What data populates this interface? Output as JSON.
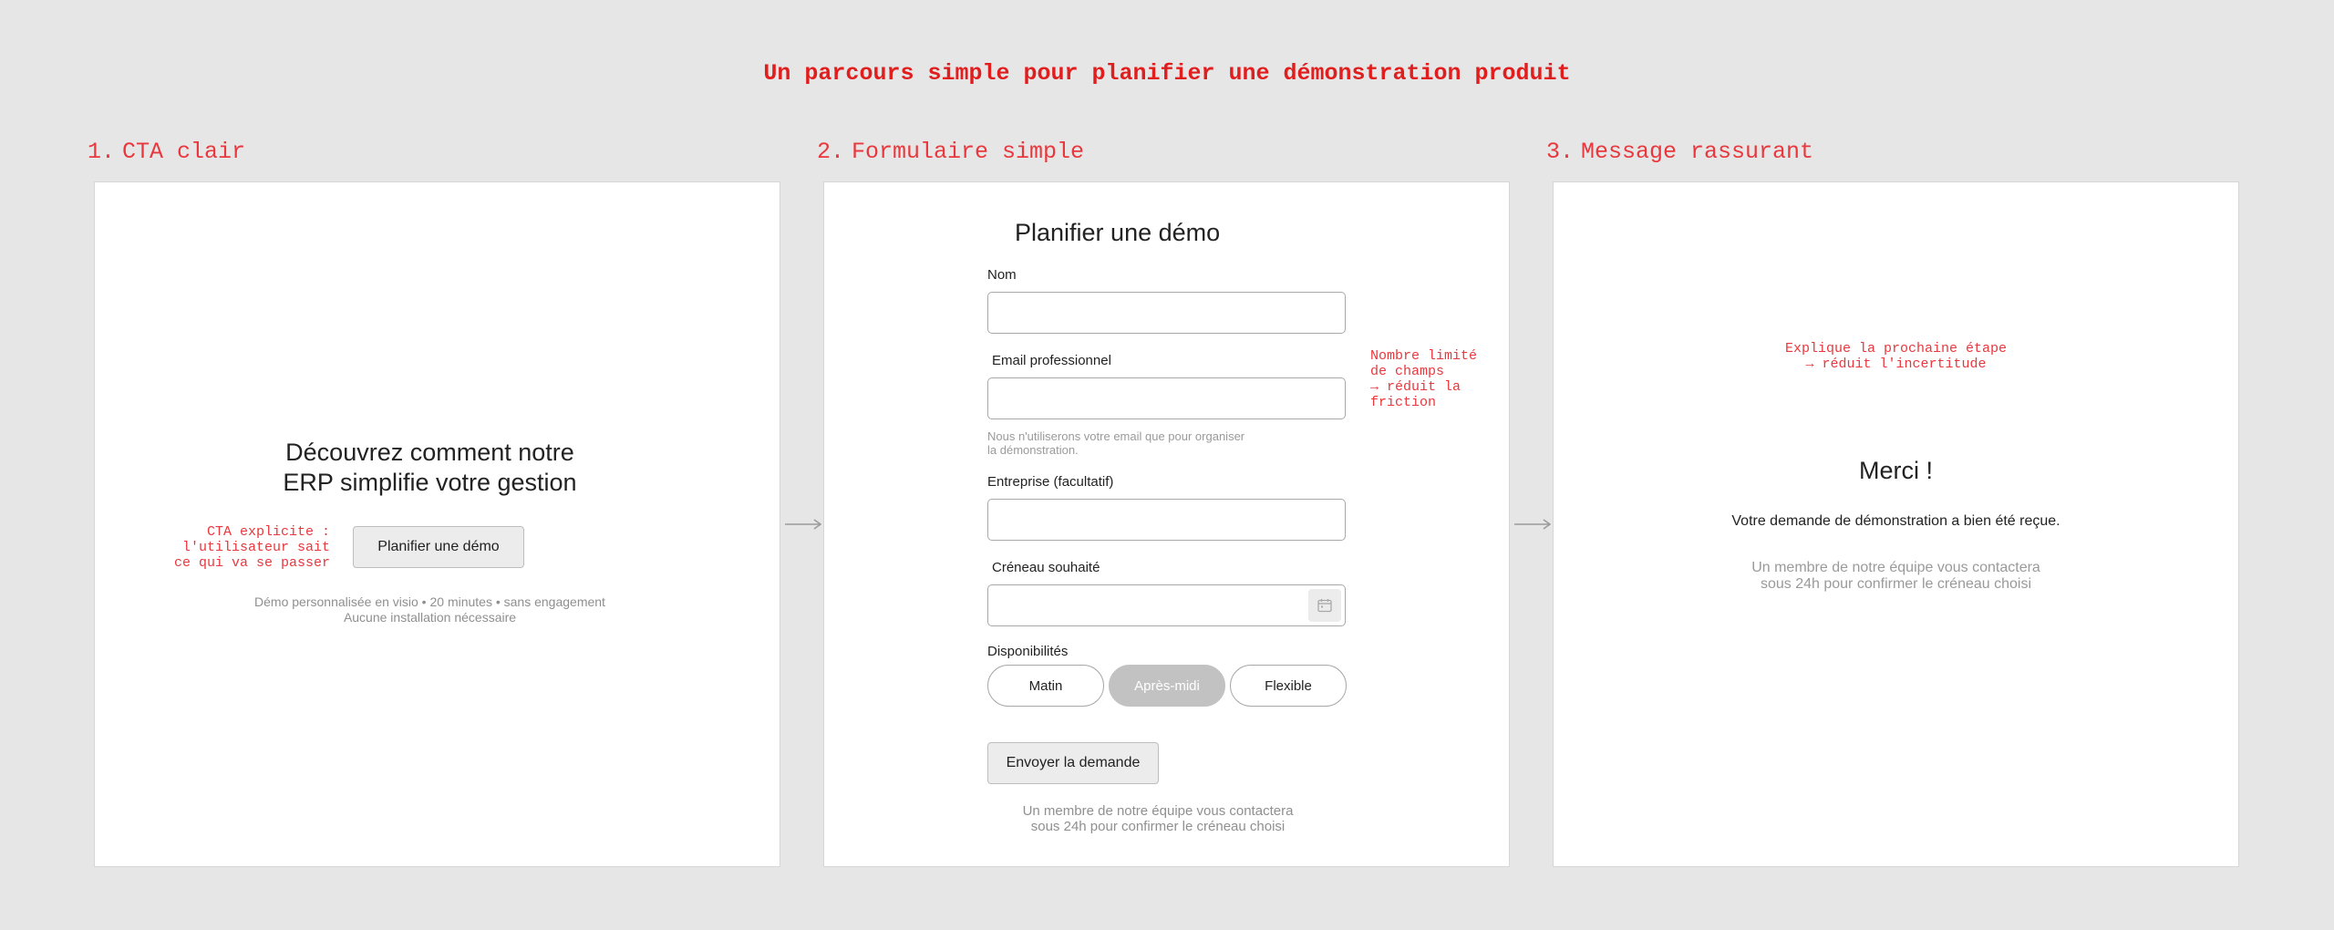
{
  "page": {
    "title": "Un parcours simple pour planifier une démonstration produit"
  },
  "steps": [
    {
      "number": "1.",
      "title": "CTA clair"
    },
    {
      "number": "2.",
      "title": "Formulaire simple"
    },
    {
      "number": "3.",
      "title": "Message rassurant"
    }
  ],
  "panel1": {
    "headline_line1": "Découvrez comment notre",
    "headline_line2": "ERP simplifie votre gestion",
    "cta_label": "Planifier une démo",
    "annotation_line1": "CTA explicite :",
    "annotation_line2": "l'utilisateur sait",
    "annotation_line3": "ce qui va se passer",
    "details_line1": "Démo personnalisée en visio • 20 minutes • sans engagement",
    "details_line2": "Aucune installation nécessaire"
  },
  "panel2": {
    "title": "Planifier une démo",
    "fields": {
      "name_label": "Nom",
      "name_value": "",
      "email_label": "Email professionnel",
      "email_value": "",
      "email_help_line1": "Nous n'utiliserons votre email que pour organiser",
      "email_help_line2": "la démonstration.",
      "company_label": "Entreprise (facultatif)",
      "company_value": "",
      "slot_label": "Créneau souhaité",
      "slot_value": "",
      "availability_label": "Disponibilités"
    },
    "availability_options": [
      {
        "label": "Matin",
        "selected": false
      },
      {
        "label": "Après-midi",
        "selected": true
      },
      {
        "label": "Flexible",
        "selected": false
      }
    ],
    "submit_label": "Envoyer la demande",
    "footer_line1": "Un membre de notre équipe vous contactera",
    "footer_line2": "sous 24h pour confirmer le créneau choisi",
    "annotation_line1": "Nombre limité",
    "annotation_line2": "de champs",
    "annotation_line3": "→ réduit la",
    "annotation_line4": "friction"
  },
  "panel3": {
    "annotation_line1": "Explique la prochaine étape",
    "annotation_line2": "→ réduit l'incertitude",
    "thanks": "Merci !",
    "confirmation": "Votre demande de démonstration a bien été reçue.",
    "followup_line1": "Un membre de notre équipe vous contactera",
    "followup_line2": "sous 24h pour confirmer le créneau choisi"
  },
  "colors": {
    "background": "#e6e6e6",
    "annotation_red": "#e8383d",
    "selected_pill": "#c2c2c2"
  },
  "icons": {
    "arrow": "arrow-right-icon",
    "calendar": "calendar-icon"
  }
}
